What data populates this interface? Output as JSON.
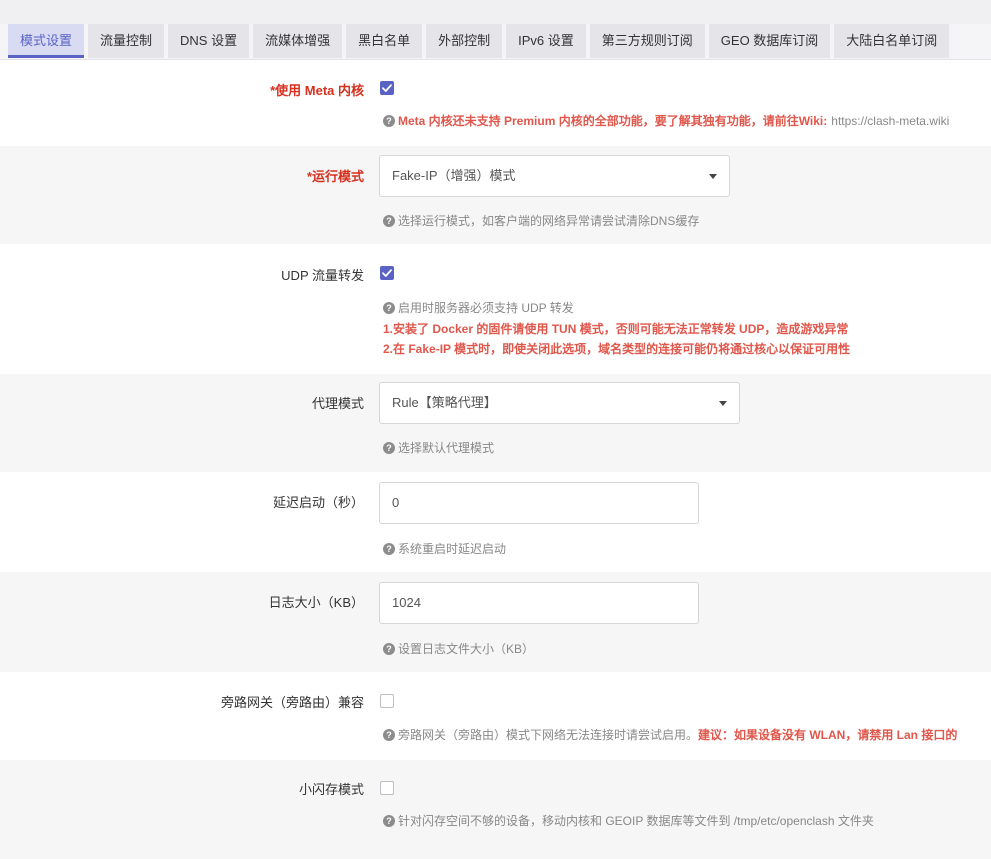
{
  "tabs": [
    "模式设置",
    "流量控制",
    "DNS 设置",
    "流媒体增强",
    "黑白名单",
    "外部控制",
    "IPv6 设置",
    "第三方规则订阅",
    "GEO 数据库订阅",
    "大陆白名单订阅"
  ],
  "active_tab": "模式设置",
  "meta_core": {
    "label": "*使用 Meta 内核",
    "checked": true,
    "help_warn": "Meta 内核还未支持 Premium 内核的全部功能，要了解其独有功能，请前往Wiki:",
    "help_link": "https://clash-meta.wiki"
  },
  "run_mode": {
    "label": "*运行模式",
    "value": "Fake-IP（增强）模式",
    "help": "选择运行模式，如客户端的网络异常请尝试清除DNS缓存"
  },
  "udp_forward": {
    "label": "UDP 流量转发",
    "checked": true,
    "help": "启用时服务器必须支持 UDP 转发",
    "warn_line1": "1.安装了 Docker 的固件请使用 TUN 模式，否则可能无法正常转发 UDP，造成游戏异常",
    "warn_line2": "2.在 Fake-IP 模式时，即使关闭此选项，域名类型的连接可能仍将通过核心以保证可用性"
  },
  "proxy_mode": {
    "label": "代理模式",
    "value": "Rule【策略代理】",
    "help": "选择默认代理模式"
  },
  "delay_start": {
    "label": "延迟启动（秒）",
    "value": "0",
    "help": "系统重启时延迟启动"
  },
  "log_size": {
    "label": "日志大小（KB）",
    "value": "1024",
    "help": "设置日志文件大小（KB）"
  },
  "bypass_gateway": {
    "label": "旁路网关（旁路由）兼容",
    "checked": false,
    "help": "旁路网关（旁路由）模式下网络无法连接时请尝试启用。",
    "help_warn": "建议：如果设备没有 WLAN，请禁用 Lan 接口的"
  },
  "small_flash": {
    "label": "小闪存模式",
    "checked": false,
    "help": "针对闪存空间不够的设备，移动内核和 GEOIP 数据库等文件到 /tmp/etc/openclash 文件夹"
  },
  "colors": {
    "accent": "#5a63c4",
    "warning": "#e0574c",
    "required": "#d6301f"
  }
}
